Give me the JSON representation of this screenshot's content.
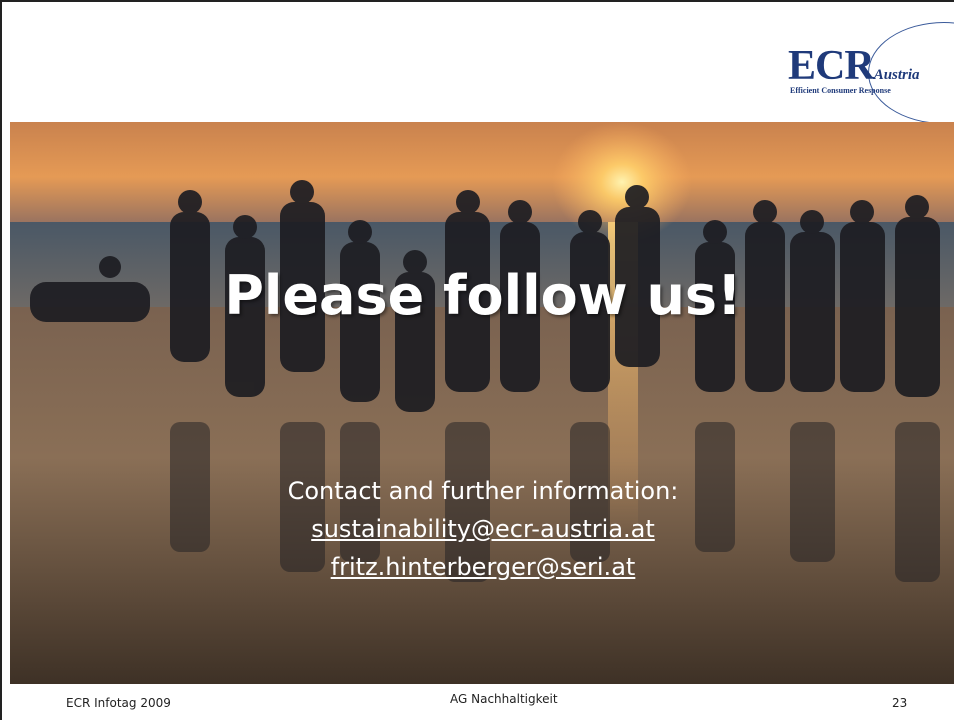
{
  "logo": {
    "brand_big": "ECR",
    "brand_small": "Austria",
    "tagline": "Efficient Consumer Response"
  },
  "slide": {
    "title": "Please follow us!",
    "contact_heading": "Contact and further information:",
    "email_1": "sustainability@ecr-austria.at",
    "email_2": "fritz.hinterberger@seri.at"
  },
  "footer": {
    "left": "ECR Infotag 2009",
    "center": "AG Nachhaltigkeit",
    "page_number": "23"
  },
  "colors": {
    "brand_blue": "#1f3a7a",
    "sky_top": "#d58a4a",
    "sun": "#ffe08a"
  }
}
